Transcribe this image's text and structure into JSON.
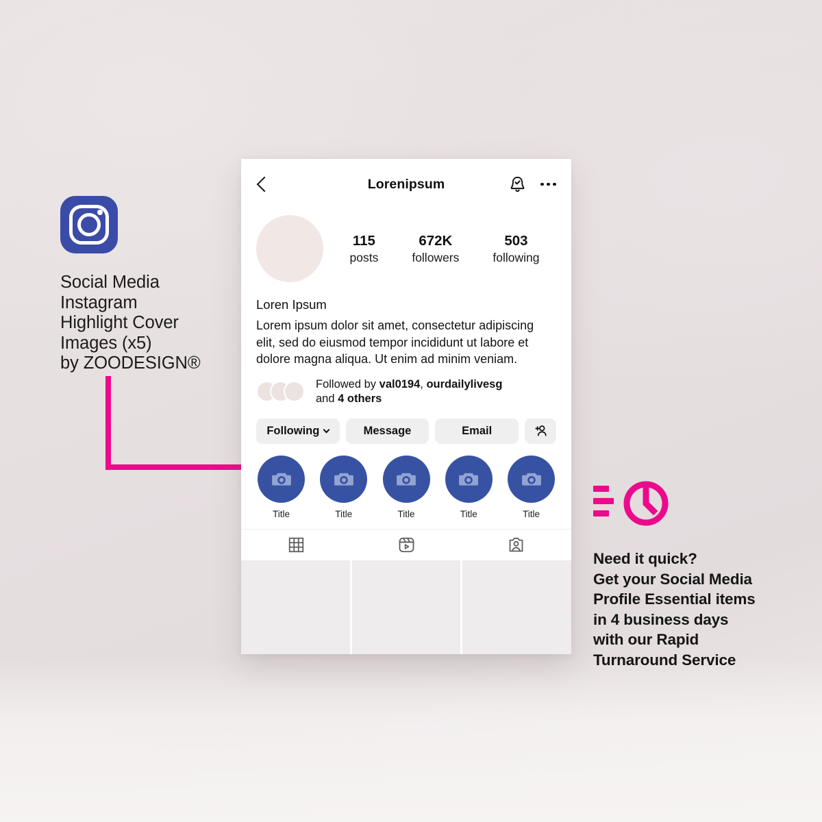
{
  "poster": {
    "background_color": "#e7e1e1",
    "accent_pink": "#ec0a8c",
    "brand_blue": "#3b4ba8",
    "highlight_blue": "#3752a2"
  },
  "left_annotation": {
    "logo_icon": "instagram-icon",
    "caption": "Social Media\nInstagram\nHighlight Cover\nImages (x5)\nby ZOODESIGN®"
  },
  "phone": {
    "app_bar": {
      "back_icon": "chevron-left-icon",
      "title": "Lorenipsum",
      "notify_icon": "bell-check-icon",
      "more_icon": "more-horizontal-icon"
    },
    "avatar": "profile-avatar",
    "stats": [
      {
        "number": "115",
        "label": "posts"
      },
      {
        "number": "672K",
        "label": "followers"
      },
      {
        "number": "503",
        "label": "following"
      }
    ],
    "bio": {
      "name": "Loren Ipsum",
      "text": "Lorem ipsum dolor sit amet, consectetur adipiscing elit, sed do eiusmod tempor incididunt ut labore et dolore magna aliqua. Ut enim ad minim veniam."
    },
    "followed_by": {
      "prefix": "Followed by ",
      "user1": "val0194",
      "separator": ", ",
      "user2": "ourdailylivesg",
      "suffix_prefix": "and ",
      "others": "4 others"
    },
    "actions": {
      "following": "Following",
      "message": "Message",
      "email": "Email",
      "add_person_icon": "add-person-icon"
    },
    "highlights": [
      {
        "icon": "camera-icon",
        "title": "Title"
      },
      {
        "icon": "camera-icon",
        "title": "Title"
      },
      {
        "icon": "camera-icon",
        "title": "Title"
      },
      {
        "icon": "camera-icon",
        "title": "Title"
      },
      {
        "icon": "camera-icon",
        "title": "Title"
      }
    ],
    "tabs": [
      {
        "icon": "grid-icon"
      },
      {
        "icon": "reels-icon"
      },
      {
        "icon": "tagged-icon"
      }
    ],
    "grid_cells": 3
  },
  "right_annotation": {
    "icon": "fast-clock-icon",
    "caption": "Need it quick?\nGet your Social Media\nProfile Essential items\nin 4 business days\nwith our Rapid\nTurnaround Service"
  }
}
